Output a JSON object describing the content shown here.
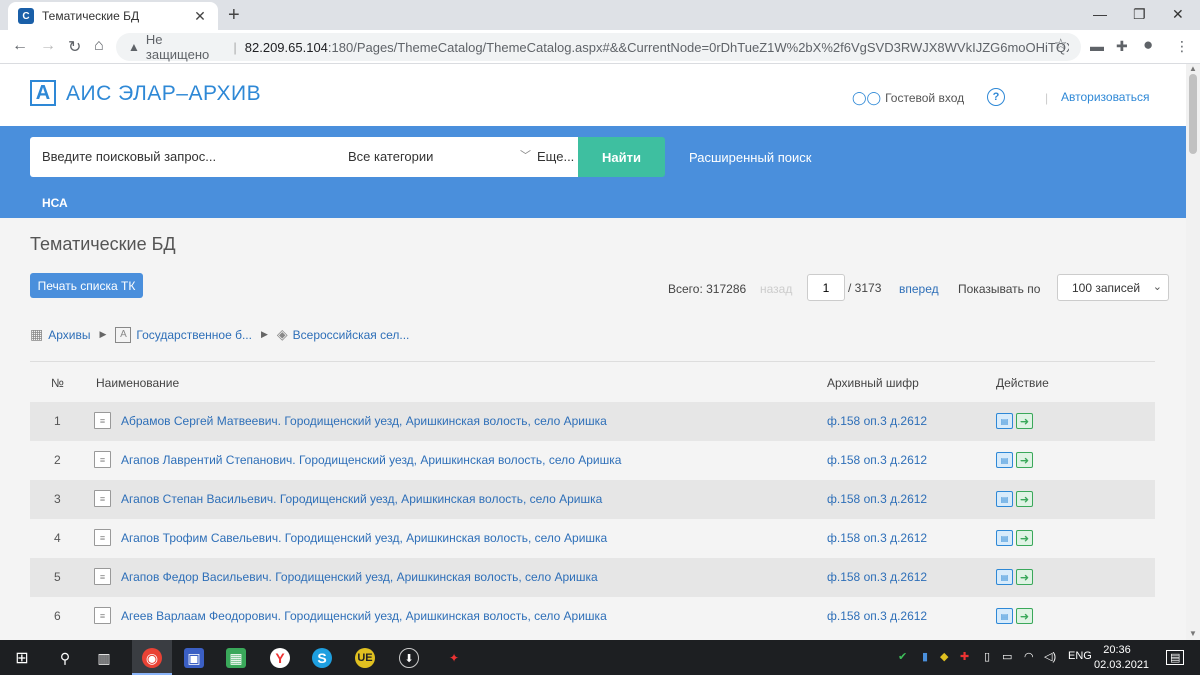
{
  "browser": {
    "tab_title": "Тематические БД",
    "insecure_label": "Не защищено",
    "url_host": "82.209.65.104",
    "url_rest": ":180/Pages/ThemeCatalog/ThemeCatalog.aspx#&&CurrentNode=0rDhTueZ1W%2bX%2f6VgSVD3RWJX8WVkIJZG6moOHiTQXQZf..."
  },
  "header": {
    "logo_letter": "A",
    "logo_text": "АИС ЭЛАР–АРХИВ",
    "guest_login": "Гостевой вход",
    "help": "?",
    "separator": "|",
    "login": "Авторизоваться"
  },
  "search": {
    "placeholder": "Введите поисковый запрос...",
    "category": "Все категории",
    "more": "Еще...",
    "find_button": "Найти",
    "advanced": "Расширенный поиск",
    "nav_nsa": "НСА"
  },
  "page": {
    "title": "Тематические БД",
    "print_button": "Печать списка ТК",
    "total": "Всего: 317286",
    "back": "назад",
    "current_page": "1",
    "pages": "/  3173",
    "next": "вперед",
    "per_page_label": "Показывать по",
    "per_page_value": "100 записей"
  },
  "breadcrumb": {
    "items": [
      "Архивы",
      "Государственное б...",
      "Всероссийская сел..."
    ]
  },
  "table": {
    "headers": {
      "num": "№",
      "name": "Наименование",
      "code": "Архивный шифр",
      "action": "Действие"
    },
    "rows": [
      {
        "num": "1",
        "name": "Абрамов Сергей Матвеевич. Городищенский уезд, Аришкинская волость, село Аришка",
        "code": "ф.158 оп.3 д.2612"
      },
      {
        "num": "2",
        "name": "Агапов Лаврентий Степанович. Городищенский уезд, Аришкинская волость, село Аришка",
        "code": "ф.158 оп.3 д.2612"
      },
      {
        "num": "3",
        "name": "Агапов Степан Васильевич. Городищенский уезд, Аришкинская волость, село Аришка",
        "code": "ф.158 оп.3 д.2612"
      },
      {
        "num": "4",
        "name": "Агапов Трофим Савельевич. Городищенский уезд, Аришкинская волость, село Аришка",
        "code": "ф.158 оп.3 д.2612"
      },
      {
        "num": "5",
        "name": "Агапов Федор Васильевич. Городищенский уезд, Аришкинская волость, село Аришка",
        "code": "ф.158 оп.3 д.2612"
      },
      {
        "num": "6",
        "name": "Агеев Варлаам Феодорович. Городищенский уезд, Аришкинская волость, село Аришка",
        "code": "ф.158 оп.3 д.2612"
      }
    ]
  },
  "taskbar": {
    "lang": "ENG",
    "time": "20:36",
    "date": "02.03.2021"
  },
  "colors": {
    "brand_blue": "#4a8fdc",
    "find_green": "#3ebfa0",
    "link_blue": "#2e6fb8"
  }
}
